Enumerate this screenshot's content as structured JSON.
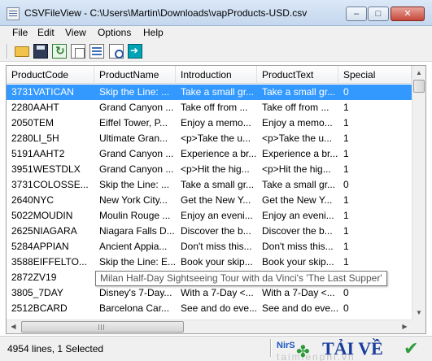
{
  "window": {
    "title": "CSVFileView - C:\\Users\\Martin\\Downloads\\vapProducts-USD.csv",
    "controls": {
      "minimize": "–",
      "maximize": "□",
      "close": "✕"
    }
  },
  "menu": [
    {
      "label": "File"
    },
    {
      "label": "Edit"
    },
    {
      "label": "View"
    },
    {
      "label": "Options"
    },
    {
      "label": "Help"
    }
  ],
  "toolbar": {
    "buttons": [
      {
        "icon": "open-folder-icon"
      },
      {
        "icon": "save-icon"
      },
      {
        "icon": "refresh-icon"
      },
      {
        "icon": "copy-icon"
      },
      {
        "icon": "html-report-icon"
      },
      {
        "icon": "find-icon"
      },
      {
        "icon": "exit-icon"
      }
    ]
  },
  "grid": {
    "columns": [
      "ProductCode",
      "ProductName",
      "Introduction",
      "ProductText",
      "Special"
    ],
    "rows": [
      [
        "3731VATICAN",
        "Skip the Line: ...",
        "Take a small gr...",
        "Take a small gr...",
        "0"
      ],
      [
        "2280AAHT",
        "Grand Canyon ...",
        "Take off from ...",
        "Take off from ...",
        "1"
      ],
      [
        "2050TEM",
        "Eiffel Tower, P...",
        "Enjoy a memo...",
        "Enjoy a memo...",
        "1"
      ],
      [
        "2280LI_5H",
        "Ultimate Gran...",
        "<p>Take the u...",
        "<p>Take the u...",
        "1"
      ],
      [
        "5191AAHT2",
        "Grand Canyon ...",
        "Experience a br...",
        "Experience a br...",
        "1"
      ],
      [
        "3951WESTDLX",
        "Grand Canyon ...",
        "<p>Hit the hig...",
        "<p>Hit the hig...",
        "1"
      ],
      [
        "3731COLOSSE...",
        "Skip the Line: ...",
        "Take a small gr...",
        "Take a small gr...",
        "0"
      ],
      [
        "2640NYC",
        "New York City...",
        "Get the New Y...",
        "Get the New Y...",
        "1"
      ],
      [
        "5022MOUDIN",
        "Moulin Rouge ...",
        "Enjoy an eveni...",
        "Enjoy an eveni...",
        "1"
      ],
      [
        "2625NIAGARA",
        "Niagara Falls D...",
        "Discover the b...",
        "Discover the b...",
        "1"
      ],
      [
        "5284APPIAN",
        "Ancient Appia...",
        "Don't miss this...",
        "Don't miss this...",
        "1"
      ],
      [
        "3588EIFFELTO...",
        "Skip the Line: E...",
        "Book your skip...",
        "Book your skip...",
        "1"
      ],
      [
        "2872ZV19",
        "",
        "",
        "",
        ""
      ],
      [
        "3805_7DAY",
        "Disney's 7-Day...",
        "With a 7-Day <...",
        "With a 7-Day <...",
        "0"
      ],
      [
        "2512BCARD",
        "Barcelona Car...",
        "See and do eve...",
        "See and do eve...",
        "0"
      ]
    ],
    "selected_row": 0
  },
  "tooltip": {
    "text": "Milan Half-Day Sightseeing Tour with da Vinci's 'The Last Supper'"
  },
  "status": {
    "summary": "4954 lines, 1 Selected",
    "link": "NirS"
  },
  "watermark": {
    "brand": "TẢI VỀ",
    "faded": "taimienphi.vn"
  }
}
